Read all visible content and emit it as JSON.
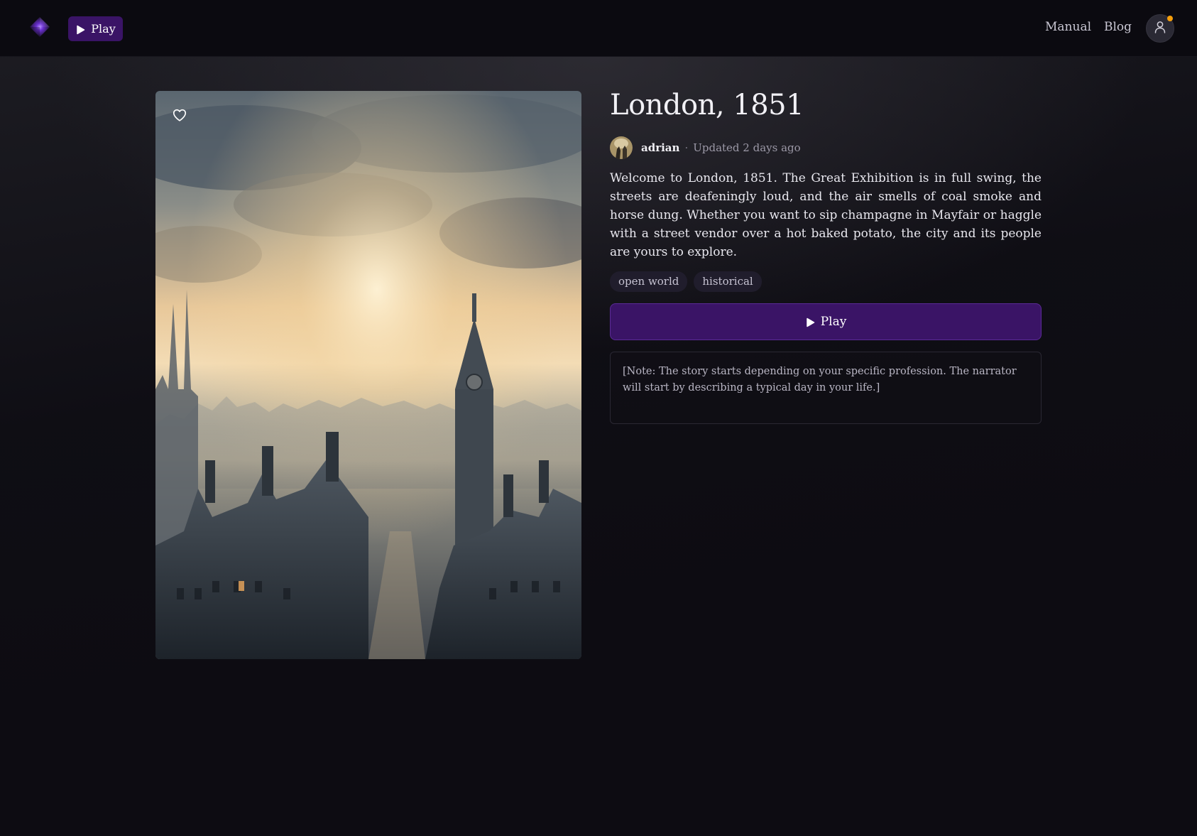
{
  "header": {
    "play_label": "Play",
    "nav": {
      "manual": "Manual",
      "blog": "Blog"
    },
    "logo_icon": "diamond-gem-icon",
    "profile_icon": "user-icon",
    "notification_color": "#f59e0b"
  },
  "game": {
    "title": "London, 1851",
    "author": "adrian",
    "separator": "·",
    "updated": "Updated 2 days ago",
    "description": "Welcome to London, 1851. The Great Exhibition is in full swing, the streets are deafeningly loud, and the air smells of coal smoke and horse dung. Whether you want to sip champagne in Mayfair or haggle with a street vendor over a hot baked potato, the city and its people are yours to explore.",
    "tags": [
      "open world",
      "historical"
    ],
    "play_label": "Play",
    "note": "[Note: The story starts depending on your specific profession. The narrator will start by describing a typical day in your life.]",
    "cover_alt": "Foggy Victorian London skyline at sunrise with clock tower",
    "like_icon": "heart-icon"
  },
  "colors": {
    "accent": "#3a1466",
    "background": "#0d0c12",
    "tag_bg": "#201d2c"
  }
}
